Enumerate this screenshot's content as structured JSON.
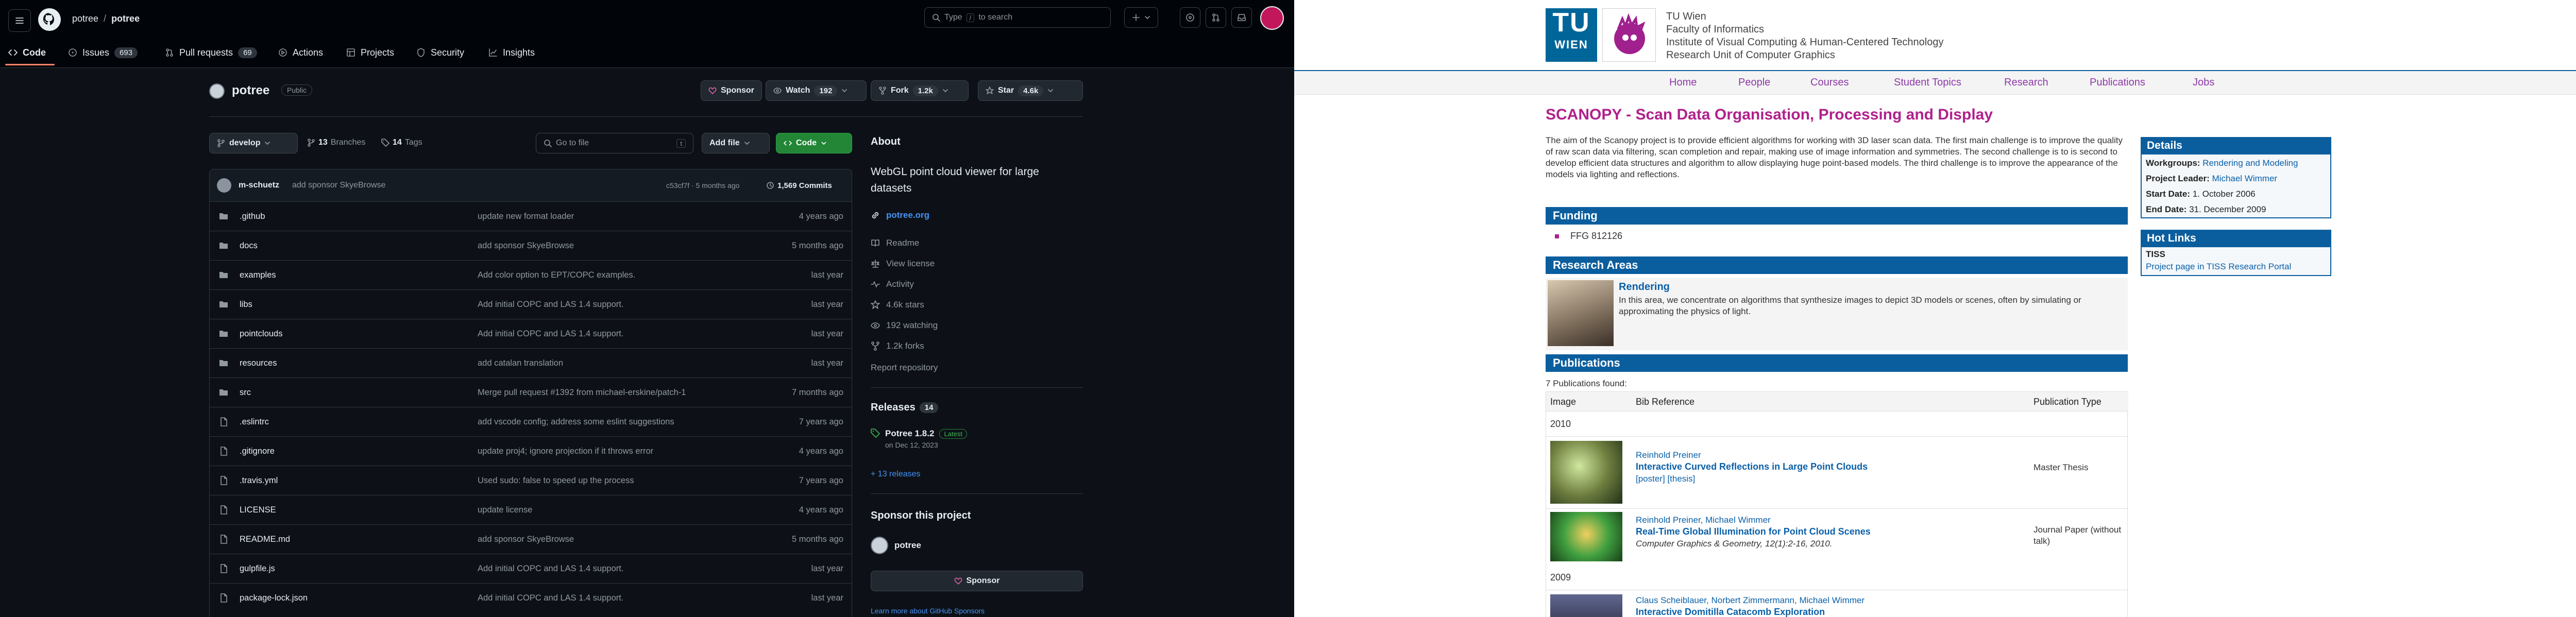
{
  "github": {
    "breadcrumb": {
      "owner": "potree",
      "separator": "/",
      "repo": "potree"
    },
    "search": {
      "placeholder_pre": "Type",
      "placeholder_key": "/",
      "placeholder_post": "to search"
    },
    "nav": [
      {
        "label": "Code",
        "count": ""
      },
      {
        "label": "Issues",
        "count": "693"
      },
      {
        "label": "Pull requests",
        "count": "69"
      },
      {
        "label": "Actions",
        "count": ""
      },
      {
        "label": "Projects",
        "count": ""
      },
      {
        "label": "Security",
        "count": ""
      },
      {
        "label": "Insights",
        "count": ""
      }
    ],
    "repo": {
      "name": "potree",
      "visibility": "Public"
    },
    "actions": {
      "sponsor": "Sponsor",
      "watch": "Watch",
      "watch_count": "192",
      "fork": "Fork",
      "fork_count": "1.2k",
      "star": "Star",
      "star_count": "4.6k"
    },
    "toolbar": {
      "branch": "develop",
      "branches_count": "13",
      "branches_label": "Branches",
      "tags_count": "14",
      "tags_label": "Tags",
      "goto_placeholder": "Go to file",
      "goto_key": "t",
      "add_file": "Add file",
      "code": "Code"
    },
    "commit": {
      "author": "m-schuetz",
      "message": "add sponsor SkyeBrowse",
      "hash_time": "c53cf7f · 5 months ago",
      "count": "1,569 Commits"
    },
    "files": [
      {
        "type": "folder",
        "name": ".github",
        "message": "update new format loader",
        "time": "4 years ago"
      },
      {
        "type": "folder",
        "name": "docs",
        "message": "add sponsor SkyeBrowse",
        "time": "5 months ago"
      },
      {
        "type": "folder",
        "name": "examples",
        "message": "Add color option to EPT/COPC examples.",
        "time": "last year"
      },
      {
        "type": "folder",
        "name": "libs",
        "message": "Add initial COPC and LAS 1.4 support.",
        "time": "last year"
      },
      {
        "type": "folder",
        "name": "pointclouds",
        "message": "Add initial COPC and LAS 1.4 support.",
        "time": "last year"
      },
      {
        "type": "folder",
        "name": "resources",
        "message": "add catalan translation",
        "time": "last year"
      },
      {
        "type": "folder",
        "name": "src",
        "message": "Merge pull request #1392 from michael-erskine/patch-1",
        "time": "7 months ago"
      },
      {
        "type": "file",
        "name": ".eslintrc",
        "message": "add vscode config; address some eslint suggestions",
        "time": "7 years ago"
      },
      {
        "type": "file",
        "name": ".gitignore",
        "message": "update proj4; ignore projection if it throws error",
        "time": "4 years ago"
      },
      {
        "type": "file",
        "name": ".travis.yml",
        "message": "Used sudo: false to speed up the process",
        "time": "7 years ago"
      },
      {
        "type": "file",
        "name": "LICENSE",
        "message": "update license",
        "time": "4 years ago"
      },
      {
        "type": "file",
        "name": "README.md",
        "message": "add sponsor SkyeBrowse",
        "time": "5 months ago"
      },
      {
        "type": "file",
        "name": "gulpfile.js",
        "message": "Add initial COPC and LAS 1.4 support.",
        "time": "last year"
      },
      {
        "type": "file",
        "name": "package-lock.json",
        "message": "Add initial COPC and LAS 1.4 support.",
        "time": "last year"
      }
    ],
    "about": {
      "heading": "About",
      "description": "WebGL point cloud viewer for large datasets",
      "link": "potree.org",
      "items": [
        "Readme",
        "View license",
        "Activity",
        "4.6k stars",
        "192 watching",
        "1.2k forks"
      ],
      "report": "Report repository"
    },
    "releases": {
      "heading": "Releases",
      "count": "14",
      "latest_name": "Potree 1.8.2",
      "latest_badge": "Latest",
      "latest_date": "on Dec 12, 2023",
      "more": "+ 13 releases"
    },
    "sponsor": {
      "heading": "Sponsor this project",
      "user": "potree",
      "button": "Sponsor",
      "learn": "Learn more about GitHub Sponsors"
    }
  },
  "tuwien": {
    "logo": {
      "line1": "TU",
      "line2": "WIEN"
    },
    "institute": [
      "TU Wien",
      "Faculty of Informatics",
      "Institute of Visual Computing & Human-Centered Technology",
      "Research Unit of Computer Graphics"
    ],
    "nav": [
      "Home",
      "People",
      "Courses",
      "Student Topics",
      "Research",
      "Publications",
      "Jobs"
    ],
    "title": "SCANOPY - Scan Data Organisation, Processing and Display",
    "intro": "The aim of the Scanopy project is to provide efficient algorithms for working with 3D laser scan data. The first main challenge is to improve the quality of raw scan data via filtering, scan completion and repair, making use of image information and symmetries. The second challenge is to is second to develop efficient data structures and algorithm to allow displaying huge point-based models. The third challenge is to improve the appearance of the models via lighting and reflections.",
    "funding": {
      "heading": "Funding",
      "item": "FFG 812126"
    },
    "research": {
      "heading": "Research Areas",
      "area": "Rendering",
      "text": "In this area, we concentrate on algorithms that synthesize images to depict 3D models or scenes, often by simulating or approximating the physics of light."
    },
    "publications": {
      "heading": "Publications",
      "found": "7 Publications found:",
      "columns": [
        "Image",
        "Bib Reference",
        "Publication Type"
      ],
      "years": [
        "2010",
        "2009"
      ],
      "entries": [
        {
          "authors": "Reinhold Preiner",
          "title": "Interactive Curved Reflections in Large Point Clouds",
          "extra": "[poster] [thesis]",
          "type": "Master Thesis"
        },
        {
          "authors": "Reinhold Preiner, Michael Wimmer",
          "title": "Real-Time Global Illumination for Point Cloud Scenes",
          "extra": "Computer Graphics & Geometry, 12(1):2-16, 2010.",
          "type": "Journal Paper (without talk)"
        },
        {
          "authors": "Claus Scheiblauer, Norbert Zimmermann, Michael Wimmer",
          "title": "Interactive Domitilla Catacomb Exploration",
          "extra": "",
          "type": ""
        }
      ]
    },
    "details": {
      "heading": "Details",
      "rows": [
        {
          "k": "Workgroups:",
          "v": "Rendering and Modeling"
        },
        {
          "k": "Project Leader:",
          "v": "Michael Wimmer"
        },
        {
          "k": "Start Date:",
          "v": "1. October 2006"
        },
        {
          "k": "End Date:",
          "v": "31. December 2009"
        }
      ]
    },
    "hotlinks": {
      "heading": "Hot Links",
      "name": "TISS",
      "link": "Project page in TISS Research Portal"
    }
  }
}
